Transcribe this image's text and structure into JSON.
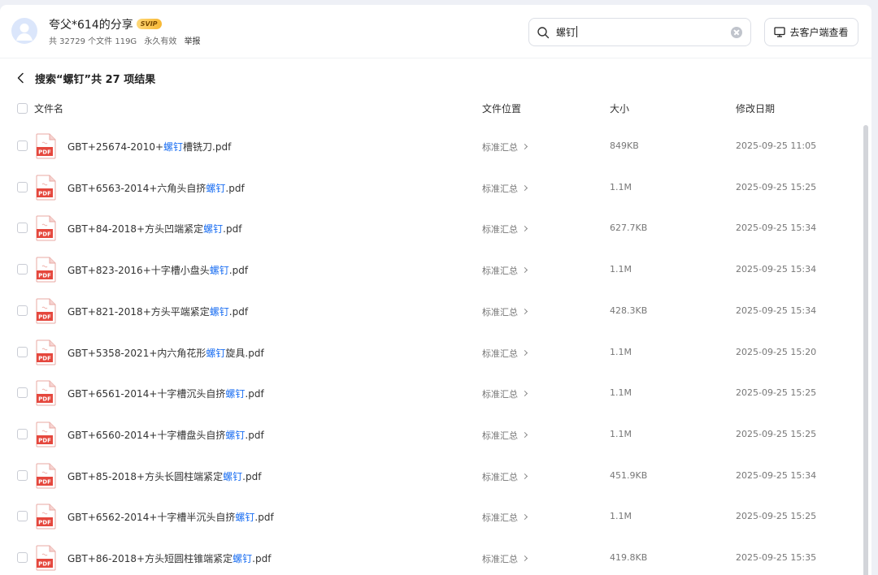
{
  "share": {
    "title": "夸父*614的分享",
    "badge": "SVIP",
    "file_count": "共 32729 个文件 119G",
    "validity": "永久有效",
    "report": "举报"
  },
  "search": {
    "value": "螺钉"
  },
  "client_button": "去客户端查看",
  "results": {
    "title": "搜索“螺钉”共 27 项结果"
  },
  "columns": {
    "name": "文件名",
    "location": "文件位置",
    "size": "大小",
    "modified": "修改日期"
  },
  "file_icon_label": "PDF",
  "files": [
    {
      "pre": "GBT+25674-2010+",
      "hl": "螺钉",
      "post": "槽铣刀.pdf",
      "location": "标准汇总",
      "size": "849KB",
      "date": "2025-09-25 11:05"
    },
    {
      "pre": "GBT+6563-2014+六角头自挤",
      "hl": "螺钉",
      "post": ".pdf",
      "location": "标准汇总",
      "size": "1.1M",
      "date": "2025-09-25 15:25"
    },
    {
      "pre": "GBT+84-2018+方头凹端紧定",
      "hl": "螺钉",
      "post": ".pdf",
      "location": "标准汇总",
      "size": "627.7KB",
      "date": "2025-09-25 15:34"
    },
    {
      "pre": "GBT+823-2016+十字槽小盘头",
      "hl": "螺钉",
      "post": ".pdf",
      "location": "标准汇总",
      "size": "1.1M",
      "date": "2025-09-25 15:34"
    },
    {
      "pre": "GBT+821-2018+方头平端紧定",
      "hl": "螺钉",
      "post": ".pdf",
      "location": "标准汇总",
      "size": "428.3KB",
      "date": "2025-09-25 15:34"
    },
    {
      "pre": "GBT+5358-2021+内六角花形",
      "hl": "螺钉",
      "post": "旋具.pdf",
      "location": "标准汇总",
      "size": "1.1M",
      "date": "2025-09-25 15:20"
    },
    {
      "pre": "GBT+6561-2014+十字槽沉头自挤",
      "hl": "螺钉",
      "post": ".pdf",
      "location": "标准汇总",
      "size": "1.1M",
      "date": "2025-09-25 15:25"
    },
    {
      "pre": "GBT+6560-2014+十字槽盘头自挤",
      "hl": "螺钉",
      "post": ".pdf",
      "location": "标准汇总",
      "size": "1.1M",
      "date": "2025-09-25 15:25"
    },
    {
      "pre": "GBT+85-2018+方头长圆柱端紧定",
      "hl": "螺钉",
      "post": ".pdf",
      "location": "标准汇总",
      "size": "451.9KB",
      "date": "2025-09-25 15:34"
    },
    {
      "pre": "GBT+6562-2014+十字槽半沉头自挤",
      "hl": "螺钉",
      "post": ".pdf",
      "location": "标准汇总",
      "size": "1.1M",
      "date": "2025-09-25 15:25"
    },
    {
      "pre": "GBT+86-2018+方头短圆柱锥端紧定",
      "hl": "螺钉",
      "post": ".pdf",
      "location": "标准汇总",
      "size": "419.8KB",
      "date": "2025-09-25 15:35"
    }
  ],
  "colors": {
    "highlight": "#1a6ef2",
    "pdf_red": "#e5473d",
    "svip_gold": "#f7b733"
  }
}
